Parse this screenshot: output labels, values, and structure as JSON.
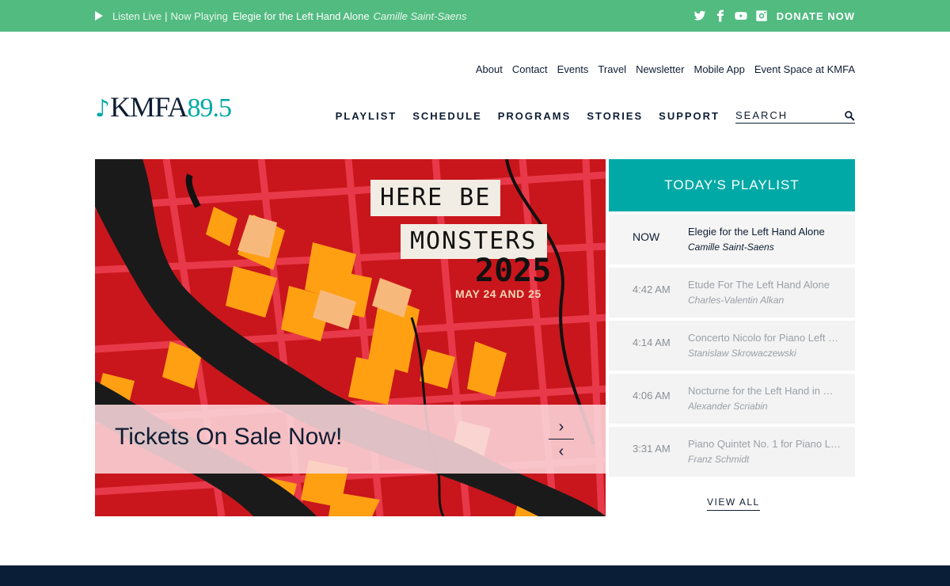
{
  "topbar": {
    "listen_live": "Listen Live",
    "separator": "|",
    "now_playing_label": "Now Playing",
    "now_playing_title": "Elegie for the Left Hand Alone",
    "now_playing_artist": "Camille Saint-Saens",
    "social_icons": [
      "twitter-icon",
      "facebook-icon",
      "youtube-icon",
      "instagram-icon"
    ],
    "donate_label": "DONATE NOW",
    "color": "#52bb80"
  },
  "logo": {
    "note": "♪",
    "call": "KMFA",
    "freq": "89.5"
  },
  "utility_nav": [
    "About",
    "Contact",
    "Events",
    "Travel",
    "Newsletter",
    "Mobile App",
    "Event Space at KMFA"
  ],
  "main_nav": [
    "PLAYLIST",
    "SCHEDULE",
    "PROGRAMS",
    "STORIES",
    "SUPPORT"
  ],
  "search": {
    "placeholder": "SEARCH"
  },
  "hero": {
    "poster_line1": "HERE BE",
    "poster_line2": "MONSTERS",
    "poster_year": "2025",
    "poster_dates": "MAY 24 AND 25",
    "caption": "Tickets On Sale Now!",
    "next_glyph": "›",
    "prev_glyph": "‹"
  },
  "playlist": {
    "heading": "TODAY'S PLAYLIST",
    "accent": "#00a9a5",
    "items": [
      {
        "time": "NOW",
        "title": "Elegie for the Left Hand Alone",
        "artist": "Camille Saint-Saens"
      },
      {
        "time": "4:42 AM",
        "title": "Etude For The Left Hand Alone",
        "artist": "Charles-Valentin Alkan"
      },
      {
        "time": "4:14 AM",
        "title": "Concerto Nicolo for Piano Left …",
        "artist": "Stanislaw Skrowaczewski"
      },
      {
        "time": "4:06 AM",
        "title": "Nocturne for the Left Hand in …",
        "artist": "Alexander Scriabin"
      },
      {
        "time": "3:31 AM",
        "title": "Piano Quintet No. 1 for Piano L…",
        "artist": "Franz Schmidt"
      }
    ],
    "view_all": "VIEW ALL"
  }
}
